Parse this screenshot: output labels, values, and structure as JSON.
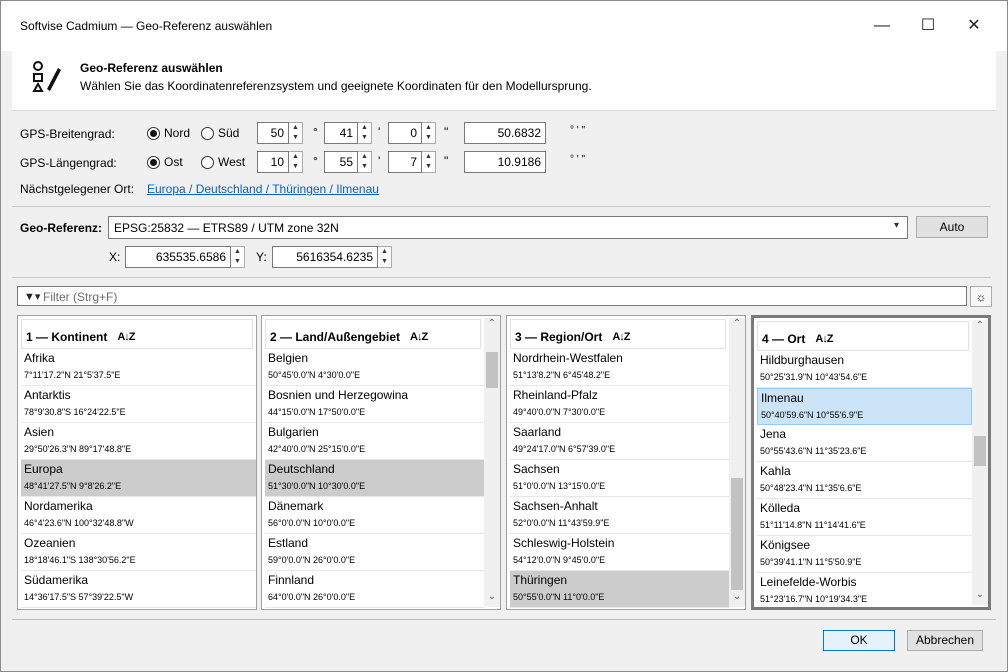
{
  "window": {
    "title": "Softvise Cadmium — Geo-Referenz auswählen"
  },
  "header": {
    "title": "Geo-Referenz auswählen",
    "subtitle": "Wählen Sie das Koordinatenreferenzsystem und geeignete Koordinaten für den Modellursprung."
  },
  "gps": {
    "lat_label": "GPS-Breitengrad:",
    "lat_north": "Nord",
    "lat_south": "Süd",
    "lat_deg": "50",
    "lat_min": "41",
    "lat_sec": "0",
    "lat_decimal": "50.6832",
    "lon_label": "GPS-Längengrad:",
    "lon_east": "Ost",
    "lon_west": "West",
    "lon_deg": "10",
    "lon_min": "55",
    "lon_sec": "7",
    "lon_decimal": "10.9186",
    "unit_deg": "°",
    "unit_min": "'",
    "unit_sec": "\"",
    "unit_dms": "° ' \"",
    "nearest_label": "Nächstgelegener Ort:",
    "nearest_link": "Europa / Deutschland / Thüringen / Ilmenau"
  },
  "georef": {
    "label": "Geo-Referenz:",
    "value": "EPSG:25832 — ETRS89 / UTM zone 32N",
    "auto_button": "Auto",
    "x_label": "X:",
    "x_value": "635535.6586",
    "y_label": "Y:",
    "y_value": "5616354.6235"
  },
  "filter": {
    "placeholder": "Filter (Strg+F)"
  },
  "panels": [
    {
      "title": "1 — Kontinent",
      "items": [
        {
          "name": "Afrika",
          "coord": "7°11'17.2\"N 21°5'37.5\"E"
        },
        {
          "name": "Antarktis",
          "coord": "78°9'30.8\"S 16°24'22.5\"E"
        },
        {
          "name": "Asien",
          "coord": "29°50'26.3\"N 89°17'48.8\"E"
        },
        {
          "name": "Europa",
          "coord": "48°41'27.5\"N 9°8'26.2\"E"
        },
        {
          "name": "Nordamerika",
          "coord": "46°4'23.6\"N 100°32'48.8\"W"
        },
        {
          "name": "Ozeanien",
          "coord": "18°18'46.1\"S 138°30'56.2\"E"
        },
        {
          "name": "Südamerika",
          "coord": "14°36'17.5\"S 57°39'22.5\"W"
        }
      ]
    },
    {
      "title": "2 — Land/Außengebiet",
      "items": [
        {
          "name": "Belgien",
          "coord": "50°45'0.0\"N 4°30'0.0\"E"
        },
        {
          "name": "Bosnien und Herzegowina",
          "coord": "44°15'0.0\"N 17°50'0.0\"E"
        },
        {
          "name": "Bulgarien",
          "coord": "42°40'0.0\"N 25°15'0.0\"E"
        },
        {
          "name": "Deutschland",
          "coord": "51°30'0.0\"N 10°30'0.0\"E"
        },
        {
          "name": "Dänemark",
          "coord": "56°0'0.0\"N 10°0'0.0\"E"
        },
        {
          "name": "Estland",
          "coord": "59°0'0.0\"N 26°0'0.0\"E"
        },
        {
          "name": "Finnland",
          "coord": "64°0'0.0\"N 26°0'0.0\"E"
        }
      ]
    },
    {
      "title": "3 — Region/Ort",
      "items": [
        {
          "name": "Nordrhein-Westfalen",
          "coord": "51°13'8.2\"N 6°45'48.2\"E"
        },
        {
          "name": "Rheinland-Pfalz",
          "coord": "49°40'0.0\"N 7°30'0.0\"E"
        },
        {
          "name": "Saarland",
          "coord": "49°24'17.0\"N 6°57'39.0\"E"
        },
        {
          "name": "Sachsen",
          "coord": "51°0'0.0\"N 13°15'0.0\"E"
        },
        {
          "name": "Sachsen-Anhalt",
          "coord": "52°0'0.0\"N 11°43'59.9\"E"
        },
        {
          "name": "Schleswig-Holstein",
          "coord": "54°12'0.0\"N 9°45'0.0\"E"
        },
        {
          "name": "Thüringen",
          "coord": "50°55'0.0\"N 11°0'0.0\"E"
        }
      ]
    },
    {
      "title": "4 — Ort",
      "items": [
        {
          "name": "Hildburghausen",
          "coord": "50°25'31.9\"N 10°43'54.6\"E"
        },
        {
          "name": "Ilmenau",
          "coord": "50°40'59.6\"N 10°55'6.9\"E"
        },
        {
          "name": "Jena",
          "coord": "50°55'43.6\"N 11°35'23.6\"E"
        },
        {
          "name": "Kahla",
          "coord": "50°48'23.4\"N 11°35'6.6\"E"
        },
        {
          "name": "Kölleda",
          "coord": "51°11'14.8\"N 11°14'41.6\"E"
        },
        {
          "name": "Königsee",
          "coord": "50°39'41.1\"N 11°5'50.9\"E"
        },
        {
          "name": "Leinefelde-Worbis",
          "coord": "51°23'16.7\"N 10°19'34.3\"E"
        }
      ]
    }
  ],
  "buttons": {
    "ok": "OK",
    "cancel": "Abbrechen"
  }
}
